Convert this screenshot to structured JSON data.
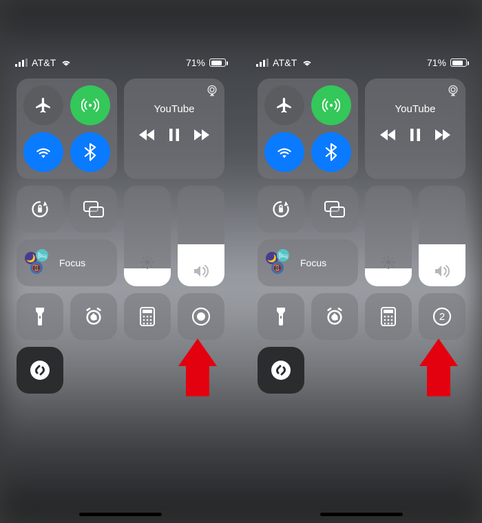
{
  "status": {
    "carrier": "AT&T",
    "battery_text": "71%",
    "battery_level": 0.71
  },
  "media": {
    "title": "YouTube"
  },
  "focus": {
    "label": "Focus"
  },
  "left": {
    "record_countdown": null
  },
  "right": {
    "record_countdown": "2"
  },
  "colors": {
    "green": "#34c759",
    "blue": "#0a7aff",
    "arrow": "#e3000f"
  }
}
